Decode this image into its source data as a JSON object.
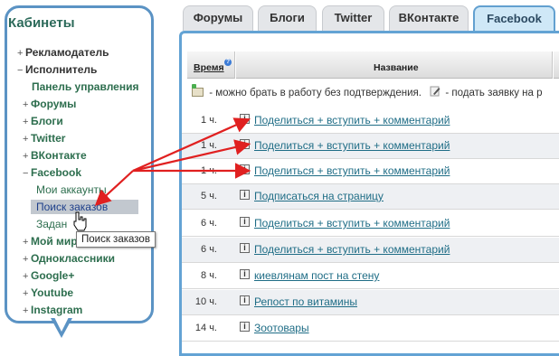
{
  "sidebar": {
    "title": "Кабинеты",
    "items": [
      {
        "marker": "+",
        "label": "Рекламодатель"
      },
      {
        "marker": "−",
        "label": "Исполнитель"
      },
      {
        "marker": "",
        "label": "Панель управления"
      },
      {
        "marker": "+",
        "label": "Форумы"
      },
      {
        "marker": "+",
        "label": "Блоги"
      },
      {
        "marker": "+",
        "label": "Twitter"
      },
      {
        "marker": "+",
        "label": "ВКонтакте"
      },
      {
        "marker": "−",
        "label": "Facebook"
      },
      {
        "marker": "+",
        "label": "Мой мир"
      },
      {
        "marker": "+",
        "label": "Одноклассники"
      },
      {
        "marker": "+",
        "label": "Google+"
      },
      {
        "marker": "+",
        "label": "Youtube"
      },
      {
        "marker": "+",
        "label": "Instagram"
      }
    ],
    "facebook_sub": [
      "Мои аккаунты",
      "Поиск заказов",
      "Задан"
    ],
    "tooltip": "Поиск заказов"
  },
  "tabs": [
    "Форумы",
    "Блоги",
    "Twitter",
    "ВКонтакте",
    "Facebook"
  ],
  "active_tab": "Facebook",
  "table": {
    "col_time": "Время",
    "col_name": "Название",
    "legend_1": " - можно брать в работу без подтверждения.",
    "legend_2": " - подать заявку на р",
    "rows": [
      {
        "time": "1 ч.",
        "title": "Поделиться + вступить + комментарий"
      },
      {
        "time": "1 ч.",
        "title": "Поделиться + вступить + комментарий"
      },
      {
        "time": "1 ч.",
        "title": "Поделиться + вступить + комментарий"
      },
      {
        "time": "5 ч.",
        "title": "Подписаться на страницу"
      },
      {
        "time": "6 ч.",
        "title": "Поделиться + вступить + комментарий"
      },
      {
        "time": "6 ч.",
        "title": "Поделиться + вступить + комментарий"
      },
      {
        "time": "8 ч.",
        "title": "киевлянам пост на стену"
      },
      {
        "time": "10 ч.",
        "title": "Репост по витамины"
      },
      {
        "time": "14 ч.",
        "title": "Зоотовары"
      }
    ]
  },
  "colors": {
    "accent": "#5b93c4",
    "arrow": "#e02020",
    "link": "#1f6d86"
  },
  "icons": [
    "info-icon",
    "new-task-icon",
    "edit-pencil-icon",
    "help-icon",
    "mouse-cursor-icon"
  ]
}
